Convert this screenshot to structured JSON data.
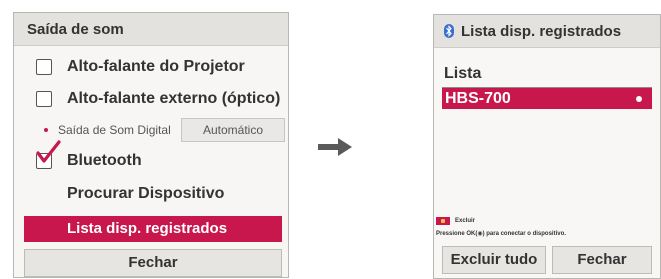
{
  "left_panel": {
    "title": "Saída de som",
    "options": [
      {
        "label": "Alto-falante do Projetor",
        "checked": false
      },
      {
        "label": "Alto-falante externo (óptico)",
        "checked": false
      }
    ],
    "digital_output": {
      "label": "Saída de Som Digital",
      "value": "Automático"
    },
    "bluetooth": {
      "label": "Bluetooth",
      "checked": true
    },
    "search_label": "Procurar Dispositivo",
    "registered_label": "Lista disp. registrados",
    "close_label": "Fechar"
  },
  "right_panel": {
    "title": "Lista disp. registrados",
    "list_heading": "Lista",
    "devices": [
      {
        "name": "HBS-700"
      }
    ],
    "legend_label": "Excluir",
    "hint": "Pressione OK(◉) para conectar o dispositivo.",
    "delete_all_label": "Excluir tudo",
    "close_label": "Fechar"
  },
  "colors": {
    "accent": "#c8174d",
    "bluetooth_icon": "#3b6fd0"
  }
}
